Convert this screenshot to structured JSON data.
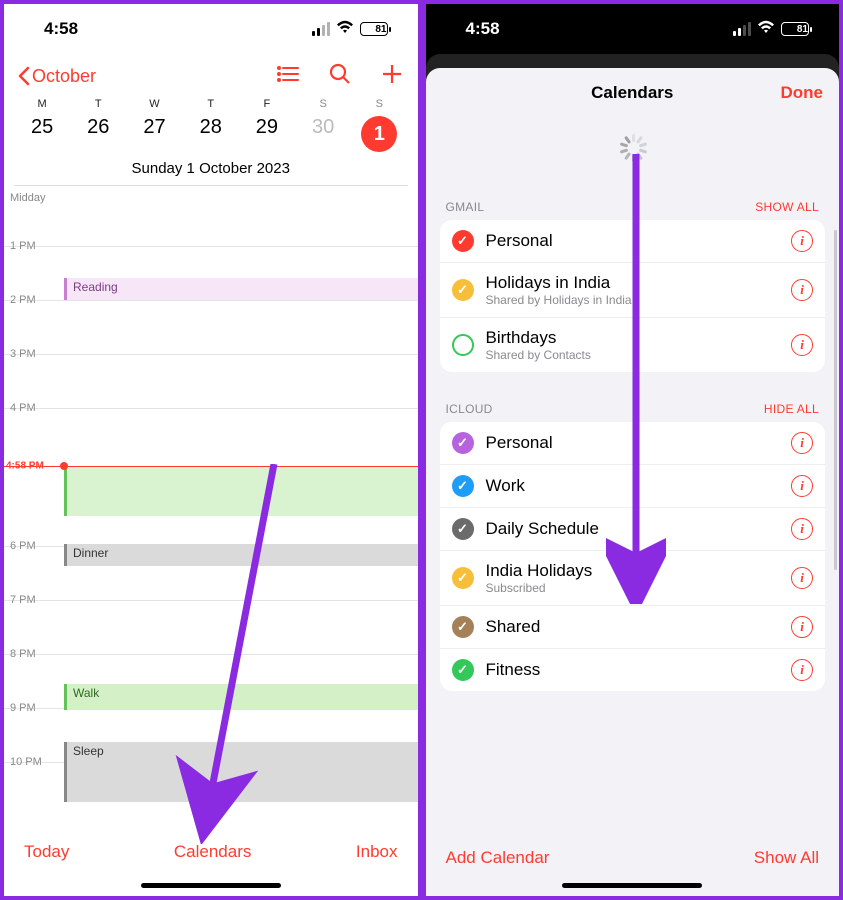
{
  "status": {
    "time": "4:58",
    "battery": "81"
  },
  "left": {
    "back": "October",
    "dow": [
      "M",
      "T",
      "W",
      "T",
      "F",
      "S",
      "S"
    ],
    "dates": [
      "25",
      "26",
      "27",
      "28",
      "29",
      "30",
      "1"
    ],
    "fullDate": "Sunday  1 October 2023",
    "midday": "Midday",
    "nowLabel": "4:58 PM",
    "hours": [
      "1 PM",
      "2 PM",
      "3 PM",
      "4 PM",
      "6 PM",
      "7 PM",
      "8 PM",
      "9 PM",
      "10 PM"
    ],
    "events": {
      "reading": "Reading",
      "dinner": "Dinner",
      "walk": "Walk",
      "sleep": "Sleep"
    },
    "footer": {
      "today": "Today",
      "calendars": "Calendars",
      "inbox": "Inbox"
    }
  },
  "right": {
    "title": "Calendars",
    "done": "Done",
    "gmail": {
      "header": "GMAIL",
      "action": "SHOW ALL",
      "items": [
        {
          "name": "Personal",
          "sub": "",
          "color": "#ff3b30",
          "state": "filled"
        },
        {
          "name": "Holidays in India",
          "sub": "Shared by Holidays in India",
          "color": "#f7be3a",
          "state": "filled"
        },
        {
          "name": "Birthdays",
          "sub": "Shared by Contacts",
          "color": "#34c759",
          "state": "hollow"
        }
      ]
    },
    "icloud": {
      "header": "ICLOUD",
      "action": "HIDE ALL",
      "items": [
        {
          "name": "Personal",
          "color": "#b763e0",
          "state": "filled"
        },
        {
          "name": "Work",
          "color": "#1e9df7",
          "state": "filled"
        },
        {
          "name": "Daily Schedule",
          "color": "#6b6b6b",
          "state": "filled"
        },
        {
          "name": "India Holidays",
          "sub": "Subscribed",
          "color": "#f7be3a",
          "state": "filled"
        },
        {
          "name": "Shared",
          "color": "#a5815a",
          "state": "filled"
        },
        {
          "name": "Fitness",
          "color": "#34c759",
          "state": "filled"
        }
      ]
    },
    "footer": {
      "add": "Add Calendar",
      "showAll": "Show All"
    }
  }
}
